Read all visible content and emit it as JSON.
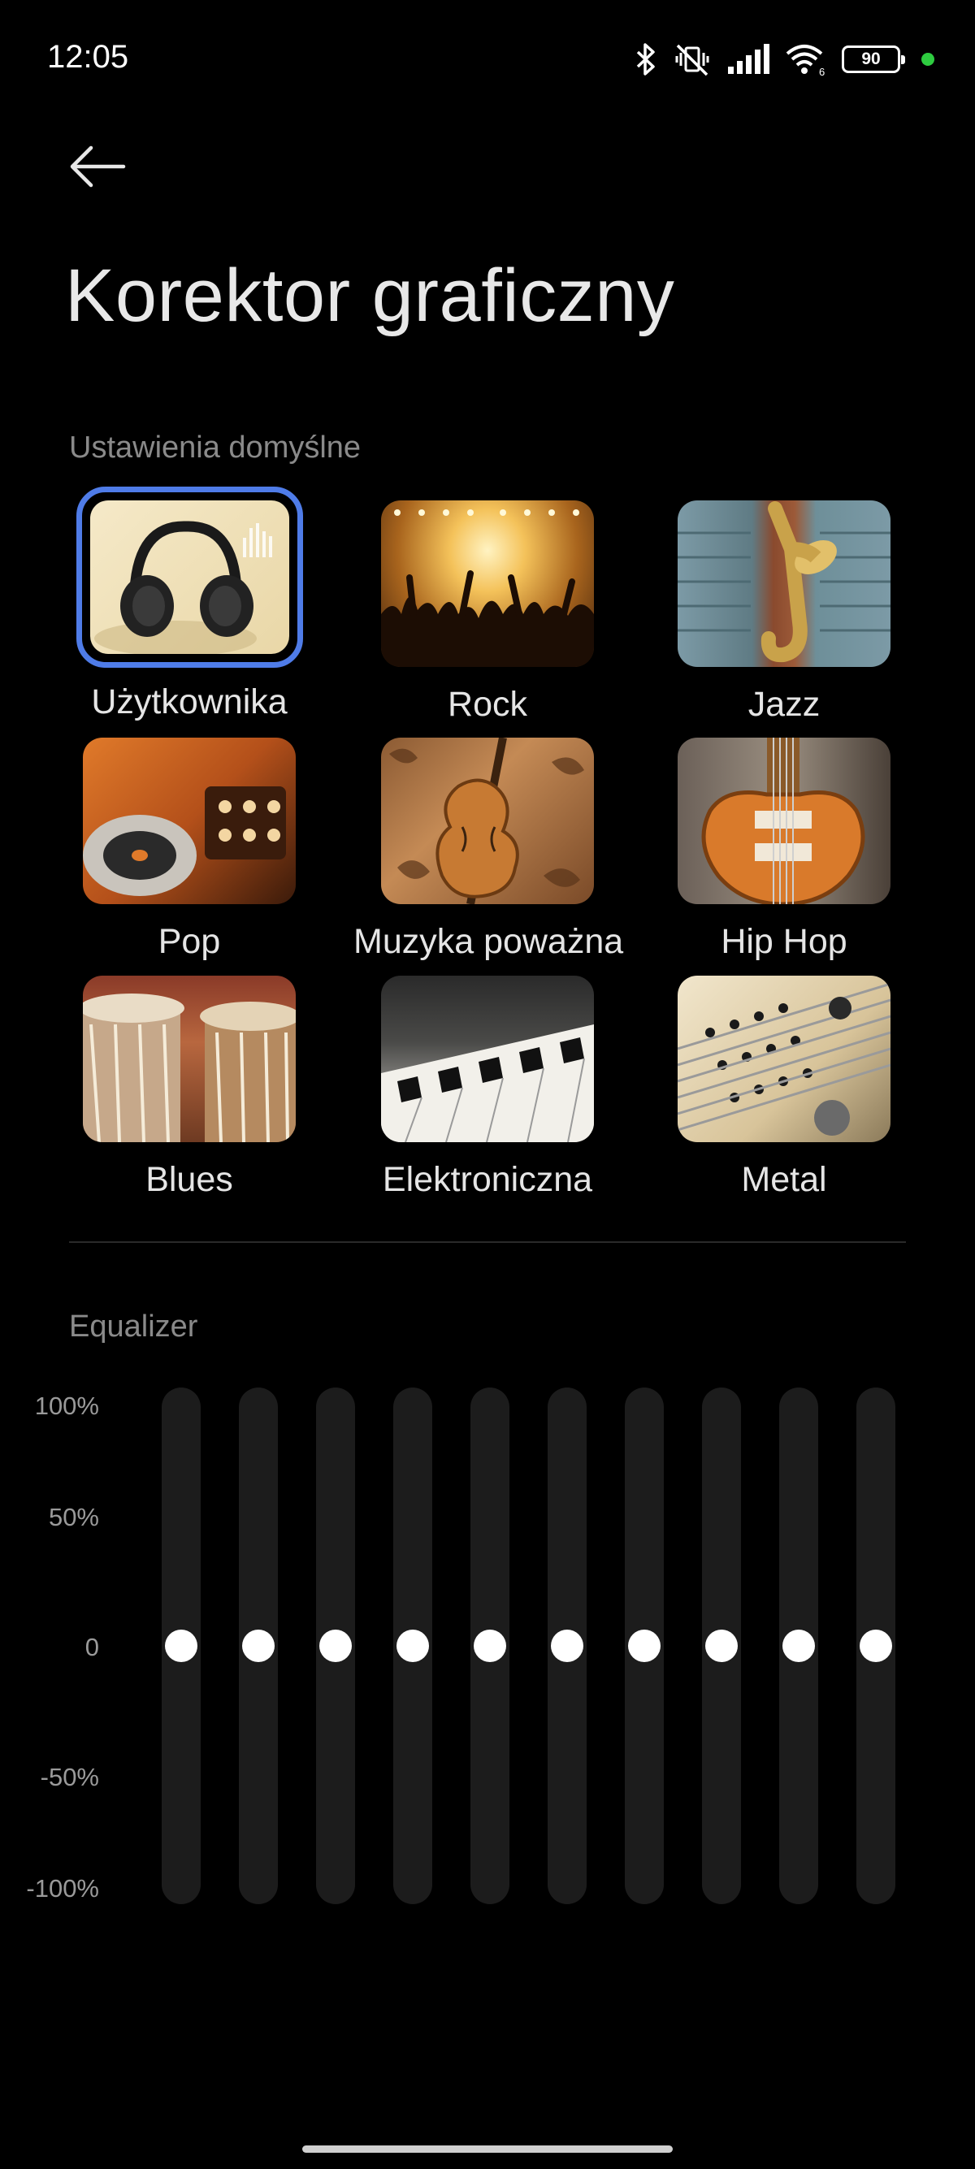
{
  "status_bar": {
    "time": "12:05",
    "battery_level": "90",
    "icons": [
      "bluetooth-icon",
      "vibrate-off-icon",
      "signal-icon",
      "wifi-icon",
      "battery-icon",
      "privacy-dot-icon"
    ],
    "accent_dot_color": "#2ecc40"
  },
  "header": {
    "back_icon": "arrow-left-icon",
    "title": "Korektor graficzny"
  },
  "presets": {
    "section_label": "Ustawienia domyślne",
    "selected": "Użytkownika",
    "selection_color": "#4f7ce8",
    "items": [
      {
        "label": "Użytkownika",
        "image": "headphones"
      },
      {
        "label": "Rock",
        "image": "concert-crowd"
      },
      {
        "label": "Jazz",
        "image": "saxophone"
      },
      {
        "label": "Pop",
        "image": "dj-turntable"
      },
      {
        "label": "Muzyka poważna",
        "image": "violin"
      },
      {
        "label": "Hip Hop",
        "image": "electric-guitar"
      },
      {
        "label": "Blues",
        "image": "tabla-drums"
      },
      {
        "label": "Elektroniczna",
        "image": "keyboard"
      },
      {
        "label": "Metal",
        "image": "guitar-strings"
      }
    ]
  },
  "equalizer": {
    "section_label": "Equalizer",
    "scale": [
      "100%",
      "50%",
      "0",
      "-50%",
      "-100%"
    ],
    "band_levels_percent": [
      0,
      0,
      0,
      0,
      0,
      0,
      0,
      0,
      0,
      0
    ]
  }
}
